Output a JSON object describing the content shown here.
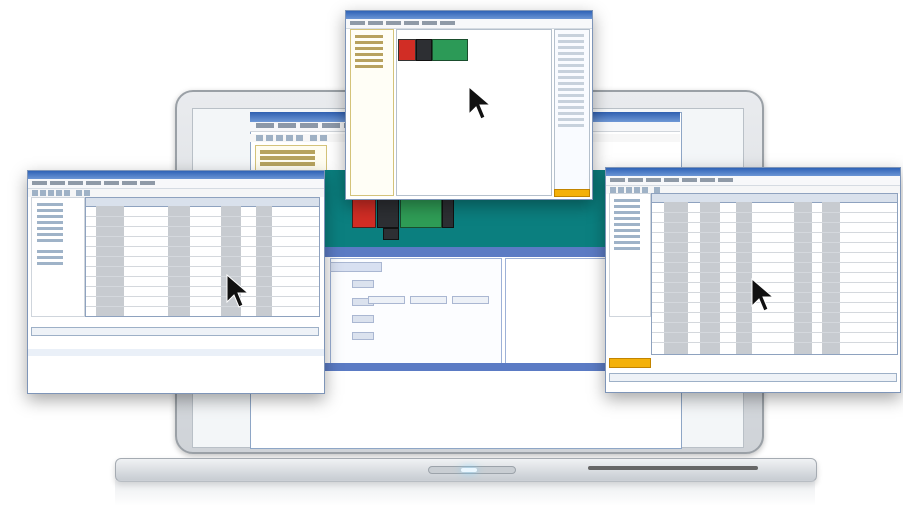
{
  "scene": {
    "description_icons": [
      "laptop-icon",
      "mouse-cursor-icon"
    ],
    "colors": {
      "titlebar_blue": "#2f63b6",
      "teal_canvas": "#0b7f7f",
      "rack_red": "#d12d25",
      "rack_green": "#2c9a57",
      "status_orange": "#f4b10a"
    }
  }
}
